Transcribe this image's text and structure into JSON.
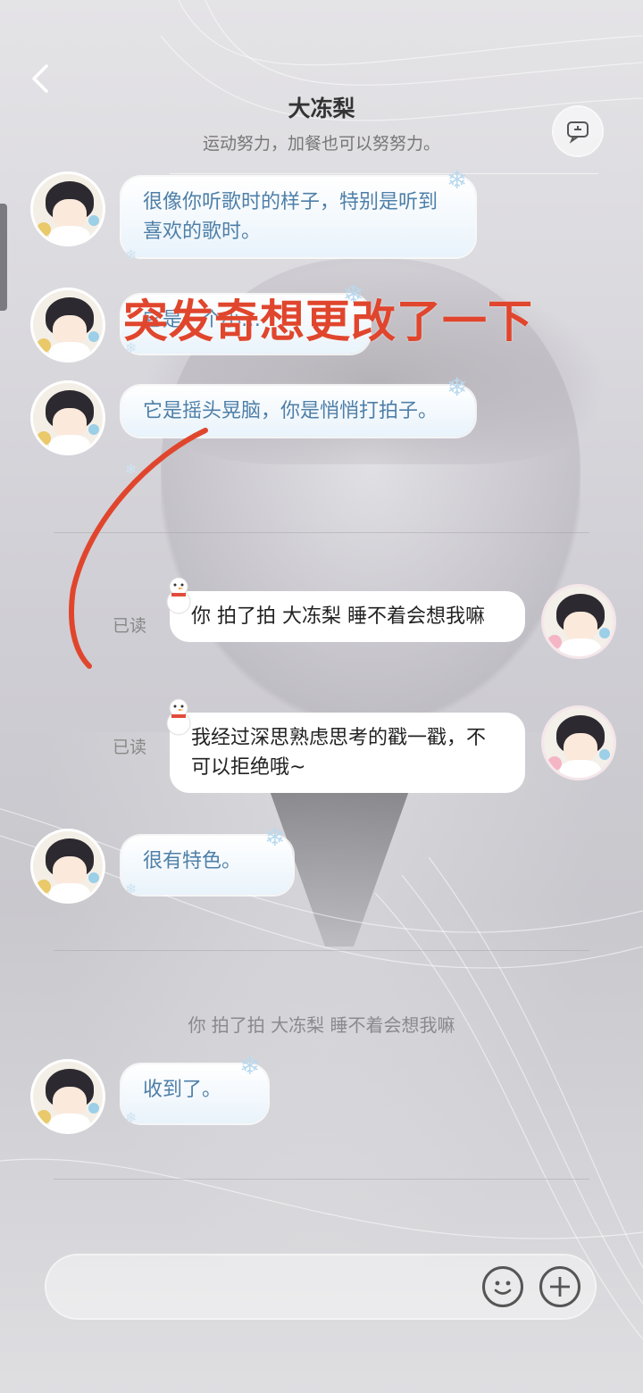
{
  "header": {
    "title": "大冻梨",
    "subtitle": "运动努力，加餐也可以努努力。",
    "back_icon": "chevron-left-icon",
    "chat_icon": "speech-bubble-icon"
  },
  "overlay": {
    "text": "突发奇想更改了一下",
    "color": "#e0462d"
  },
  "messages": [
    {
      "side": "in",
      "text": "很像你听歌时的样子，特别是听到喜欢的歌时。"
    },
    {
      "side": "in",
      "text": "它是一个小…"
    },
    {
      "side": "in",
      "text": "它是摇头晃脑，你是悄悄打拍子。"
    },
    {
      "side": "out",
      "status": "已读",
      "text": "你 拍了拍 大冻梨 睡不着会想我嘛"
    },
    {
      "side": "out",
      "status": "已读",
      "text": "我经过深思熟虑思考的戳一戳，不可以拒绝哦~"
    },
    {
      "side": "in",
      "text": "很有特色。"
    },
    {
      "side": "in",
      "text": "收到了。"
    }
  ],
  "system_notice": "你 拍了拍 大冻梨 睡不着会想我嘛",
  "input": {
    "placeholder": "",
    "emoji_icon": "smiley-icon",
    "plus_icon": "plus-icon"
  },
  "colors": {
    "incoming_text": "#4e7fa8",
    "outgoing_bg": "#ffffff",
    "accent_red": "#e0462d"
  }
}
